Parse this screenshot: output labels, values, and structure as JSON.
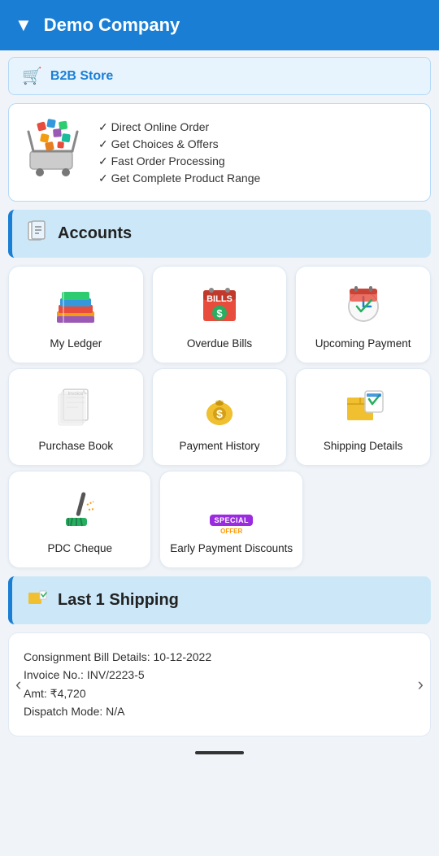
{
  "header": {
    "title": "Demo Company",
    "chevron": "▼"
  },
  "b2b_strip": {
    "icon": "🛒",
    "title": "B2B Store"
  },
  "b2b_banner": {
    "features": [
      "Direct Online Order",
      "Get Choices & Offers",
      "Fast Order Processing",
      "Get Complete Product Range"
    ]
  },
  "accounts_section": {
    "title": "Accounts",
    "icon": "📋"
  },
  "cards_row1": [
    {
      "label": "My Ledger",
      "icon": "📚"
    },
    {
      "label": "Overdue Bills",
      "icon": "💵"
    },
    {
      "label": "Upcoming Payment",
      "icon": "📅"
    }
  ],
  "cards_row2": [
    {
      "label": "Purchase Book",
      "icon": "🧾"
    },
    {
      "label": "Payment History",
      "icon": "💰"
    },
    {
      "label": "Shipping Details",
      "icon": "📦"
    }
  ],
  "cards_row3": [
    {
      "label": "PDC Cheque",
      "icon": "🖊️"
    },
    {
      "label": "Early Payment Discounts",
      "icon": "🏷️"
    }
  ],
  "last_shipping": {
    "section_title": "Last 1 Shipping",
    "section_icon": "📦",
    "consignment_label": "Consignment Bill Details:",
    "consignment_date": "10-12-2022",
    "invoice_label": "Invoice No.:",
    "invoice_no": "INV/2223-5",
    "amount_label": "Amt:",
    "amount": "₹4,720",
    "dispatch_label": "Dispatch Mode:",
    "dispatch_mode": "N/A"
  }
}
